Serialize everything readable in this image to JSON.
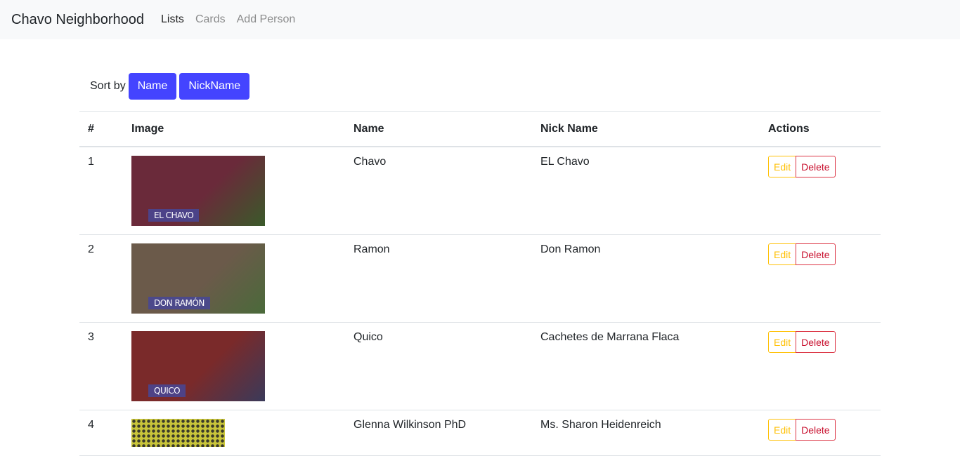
{
  "navbar": {
    "brand": "Chavo Neighborhood",
    "links": [
      {
        "label": "Lists",
        "active": true
      },
      {
        "label": "Cards",
        "active": false
      },
      {
        "label": "Add Person",
        "active": false
      }
    ]
  },
  "sort": {
    "label": "Sort by",
    "buttons": [
      "Name",
      "NickName"
    ],
    "accent": "#4444ff"
  },
  "table": {
    "headers": [
      "#",
      "Image",
      "Name",
      "Nick Name",
      "Actions"
    ],
    "rows": [
      {
        "num": "1",
        "name": "Chavo",
        "nick": "EL Chavo",
        "image_caption": "EL CHAVO",
        "image_colors": [
          "#6a2a3a",
          "#3a5a2a"
        ]
      },
      {
        "num": "2",
        "name": "Ramon",
        "nick": "Don Ramon",
        "image_caption": "DON RAMÓN",
        "image_colors": [
          "#6b5a4a",
          "#4a6a3a"
        ]
      },
      {
        "num": "3",
        "name": "Quico",
        "nick": "Cachetes de Marrana Flaca",
        "image_caption": "QUICO",
        "image_colors": [
          "#7a2a2a",
          "#3a3a5a"
        ]
      },
      {
        "num": "4",
        "name": "Glenna Wilkinson PhD",
        "nick": "Ms. Sharon Heidenreich",
        "image_caption": "",
        "image_colors": [
          "#c8c43a",
          "#3a3a2a"
        ]
      }
    ],
    "edit_label": "Edit",
    "delete_label": "Delete"
  }
}
